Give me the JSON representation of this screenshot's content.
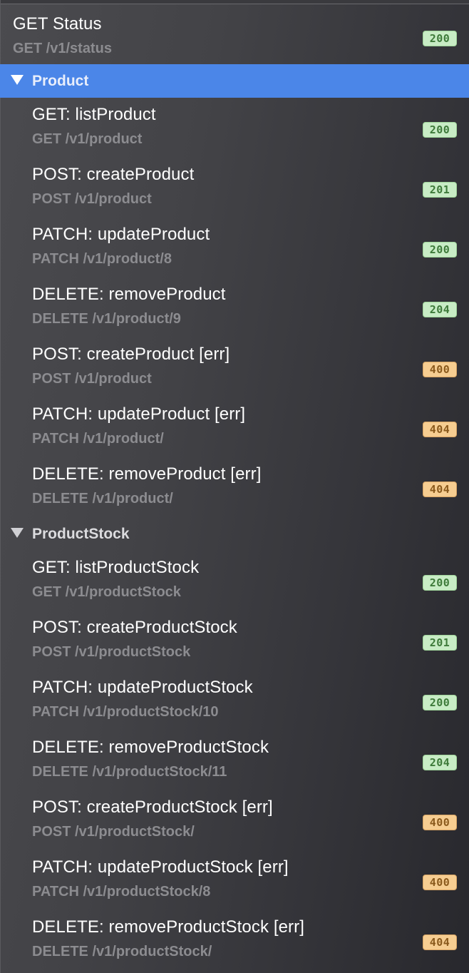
{
  "top_item": {
    "title": "GET Status",
    "sub": "GET /v1/status",
    "status": "200"
  },
  "groups": [
    {
      "label": "Product",
      "selected": true,
      "items": [
        {
          "title": "GET: listProduct",
          "sub": "GET /v1/product",
          "status": "200",
          "kind": "ok"
        },
        {
          "title": "POST: createProduct",
          "sub": "POST /v1/product",
          "status": "201",
          "kind": "ok"
        },
        {
          "title": "PATCH: updateProduct",
          "sub": "PATCH /v1/product/8",
          "status": "200",
          "kind": "ok"
        },
        {
          "title": "DELETE: removeProduct",
          "sub": "DELETE /v1/product/9",
          "status": "204",
          "kind": "ok"
        },
        {
          "title": "POST: createProduct [err]",
          "sub": "POST /v1/product",
          "status": "400",
          "kind": "err"
        },
        {
          "title": "PATCH: updateProduct [err]",
          "sub": "PATCH /v1/product/",
          "status": "404",
          "kind": "err"
        },
        {
          "title": "DELETE: removeProduct [err]",
          "sub": "DELETE /v1/product/",
          "status": "404",
          "kind": "err"
        }
      ]
    },
    {
      "label": "ProductStock",
      "selected": false,
      "items": [
        {
          "title": "GET: listProductStock",
          "sub": "GET /v1/productStock",
          "status": "200",
          "kind": "ok"
        },
        {
          "title": "POST: createProductStock",
          "sub": "POST /v1/productStock",
          "status": "201",
          "kind": "ok"
        },
        {
          "title": "PATCH: updateProductStock",
          "sub": "PATCH /v1/productStock/10",
          "status": "200",
          "kind": "ok"
        },
        {
          "title": "DELETE: removeProductStock",
          "sub": "DELETE /v1/productStock/11",
          "status": "204",
          "kind": "ok"
        },
        {
          "title": "POST: createProductStock [err]",
          "sub": "POST /v1/productStock/",
          "status": "400",
          "kind": "err"
        },
        {
          "title": "PATCH: updateProductStock [err]",
          "sub": "PATCH /v1/productStock/8",
          "status": "400",
          "kind": "err"
        },
        {
          "title": "DELETE: removeProductStock [err]",
          "sub": "DELETE /v1/productStock/",
          "status": "404",
          "kind": "err"
        }
      ]
    }
  ],
  "colors": {
    "selected_group_bg": "#4b86e8",
    "badge_ok_bg": "#c8ecc5",
    "badge_err_bg": "#f6cd91"
  },
  "icons": {
    "group_toggle": "disclosure-triangle-down-icon"
  }
}
